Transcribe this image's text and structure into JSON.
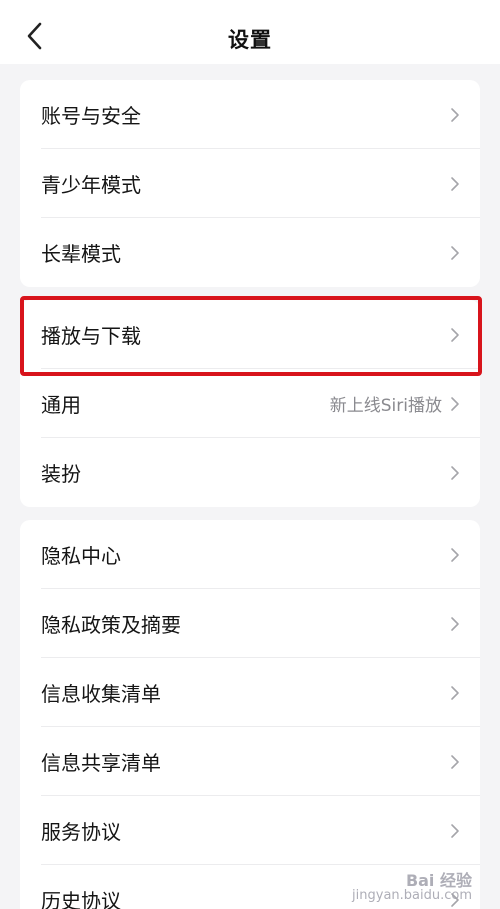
{
  "header": {
    "title": "设置",
    "back_icon": "chevron-left-icon"
  },
  "groups": [
    {
      "items": [
        {
          "label": "账号与安全",
          "value": ""
        },
        {
          "label": "青少年模式",
          "value": ""
        },
        {
          "label": "长辈模式",
          "value": ""
        }
      ]
    },
    {
      "items": [
        {
          "label": "播放与下载",
          "value": "",
          "highlighted": true
        },
        {
          "label": "通用",
          "value": "新上线Siri播放"
        },
        {
          "label": "装扮",
          "value": ""
        }
      ]
    },
    {
      "items": [
        {
          "label": "隐私中心",
          "value": ""
        },
        {
          "label": "隐私政策及摘要",
          "value": ""
        },
        {
          "label": "信息收集清单",
          "value": ""
        },
        {
          "label": "信息共享清单",
          "value": ""
        },
        {
          "label": "服务协议",
          "value": ""
        },
        {
          "label": "历史协议",
          "value": ""
        }
      ]
    }
  ],
  "annotation": {
    "highlight_color": "#d8141c"
  },
  "watermark": {
    "line1": "Bai 经验",
    "line2": "jingyan.baidu.com"
  }
}
